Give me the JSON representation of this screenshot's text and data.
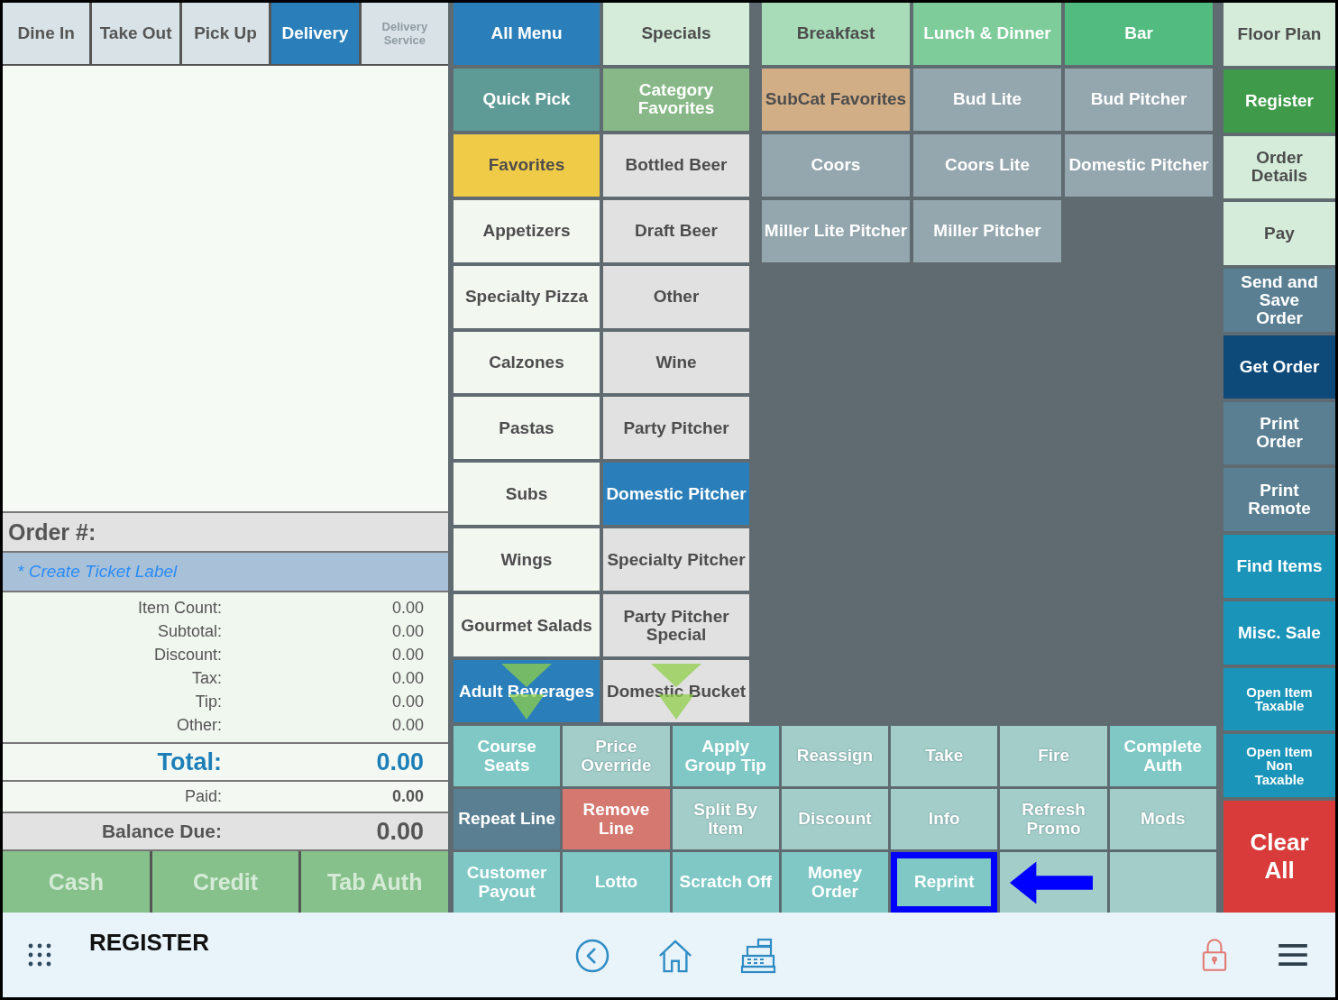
{
  "order_tabs": [
    {
      "label": "Dine In",
      "selected": false,
      "disabled": false
    },
    {
      "label": "Take Out",
      "selected": false,
      "disabled": false
    },
    {
      "label": "Pick Up",
      "selected": false,
      "disabled": false
    },
    {
      "label": "Delivery",
      "selected": true,
      "disabled": false
    },
    {
      "label": "Delivery Service",
      "selected": false,
      "disabled": true
    }
  ],
  "order": {
    "number_label": "Order #:",
    "ticket_label": "* Create Ticket Label",
    "summary": [
      {
        "label": "Item Count:",
        "value": "0.00"
      },
      {
        "label": "Subtotal:",
        "value": "0.00"
      },
      {
        "label": "Discount:",
        "value": "0.00"
      },
      {
        "label": "Tax:",
        "value": "0.00"
      },
      {
        "label": "Tip:",
        "value": "0.00"
      },
      {
        "label": "Other:",
        "value": "0.00"
      }
    ],
    "total": {
      "label": "Total:",
      "value": "0.00"
    },
    "paid": {
      "label": "Paid:",
      "value": "0.00"
    },
    "balance": {
      "label": "Balance Due:",
      "value": "0.00"
    }
  },
  "payment_buttons": [
    {
      "label": "Cash",
      "disabled": true
    },
    {
      "label": "Credit",
      "disabled": true
    },
    {
      "label": "Tab Auth",
      "disabled": true
    }
  ],
  "categories": {
    "more_below": true,
    "items": [
      {
        "label": "All Menu",
        "color": "#2a7fba"
      },
      {
        "label": "Quick Pick",
        "color": "#5f9b96"
      },
      {
        "label": "Favorites",
        "color": "#f0cb48"
      },
      {
        "label": "Appetizers",
        "color": "#f2f7f0"
      },
      {
        "label": "Specialty Pizza",
        "color": "#f2f7f0"
      },
      {
        "label": "Calzones",
        "color": "#f2f7f0"
      },
      {
        "label": "Pastas",
        "color": "#f2f7f0"
      },
      {
        "label": "Subs",
        "color": "#f2f7f0"
      },
      {
        "label": "Wings",
        "color": "#f2f7f0"
      },
      {
        "label": "Gourmet Salads",
        "color": "#f2f7f0"
      },
      {
        "label": "Adult Beverages",
        "color": "#2a7fba"
      }
    ]
  },
  "subcategories": {
    "more_below": true,
    "items": [
      {
        "label": "Specials",
        "color": "#d4ecd9"
      },
      {
        "label": "Category Favorites",
        "color": "#88b887"
      },
      {
        "label": "Bottled Beer",
        "color": "#e1e1e1"
      },
      {
        "label": "Draft Beer",
        "color": "#e1e1e1"
      },
      {
        "label": "Other",
        "color": "#e1e1e1"
      },
      {
        "label": "Wine",
        "color": "#e1e1e1"
      },
      {
        "label": "Party Pitcher",
        "color": "#e1e1e1"
      },
      {
        "label": "Domestic Pitcher",
        "color": "#2a7fba"
      },
      {
        "label": "Specialty Pitcher",
        "color": "#e1e1e1"
      },
      {
        "label": "Party Pitcher Special",
        "color": "#e1e1e1"
      },
      {
        "label": "Domestic Bucket",
        "color": "#e1e1e1"
      }
    ]
  },
  "menu_items": [
    {
      "label": "Breakfast",
      "color": "#a8dcb8"
    },
    {
      "label": "Lunch & Dinner",
      "color": "#7dcc9a"
    },
    {
      "label": "Bar",
      "color": "#52bb80"
    },
    {
      "label": "SubCat Favorites",
      "color": "#d2ae86"
    },
    {
      "label": "Bud Lite",
      "color": "#94a6ae"
    },
    {
      "label": "Bud Pitcher",
      "color": "#94a6ae"
    },
    {
      "label": "Coors",
      "color": "#94a6ae"
    },
    {
      "label": "Coors Lite",
      "color": "#94a6ae"
    },
    {
      "label": "Domestic Pitcher",
      "color": "#94a6ae"
    },
    {
      "label": "Miller Lite Pitcher",
      "color": "#94a6ae"
    },
    {
      "label": "Miller Pitcher",
      "color": "#94a6ae"
    }
  ],
  "actions": [
    {
      "label": "Course Seats",
      "color": "#7fc8c5",
      "disabled": false,
      "highlighted": false
    },
    {
      "label": "Price Override",
      "color": "#a2cdc9",
      "disabled": true,
      "highlighted": false
    },
    {
      "label": "Apply Group Tip",
      "color": "#7fc8c5",
      "disabled": false,
      "highlighted": false
    },
    {
      "label": "Reassign",
      "color": "#a2cdc9",
      "disabled": true,
      "highlighted": false
    },
    {
      "label": "Take",
      "color": "#a2cdc9",
      "disabled": true,
      "highlighted": false
    },
    {
      "label": "Fire",
      "color": "#a2cdc9",
      "disabled": true,
      "highlighted": false
    },
    {
      "label": "Complete Auth",
      "color": "#7fc8c5",
      "disabled": false,
      "highlighted": false
    },
    {
      "label": "Repeat Line",
      "color": "#5a7f92",
      "disabled": false,
      "highlighted": false
    },
    {
      "label": "Remove Line",
      "color": "#d57870",
      "disabled": false,
      "highlighted": false
    },
    {
      "label": "Split By Item",
      "color": "#a2cdc9",
      "disabled": true,
      "highlighted": false
    },
    {
      "label": "Discount",
      "color": "#a2cdc9",
      "disabled": true,
      "highlighted": false
    },
    {
      "label": "Info",
      "color": "#a2cdc9",
      "disabled": true,
      "highlighted": false
    },
    {
      "label": "Refresh Promo",
      "color": "#a2cdc9",
      "disabled": true,
      "highlighted": false
    },
    {
      "label": "Mods",
      "color": "#a2cdc9",
      "disabled": true,
      "highlighted": false
    },
    {
      "label": "Customer Payout",
      "color": "#7fc8c5",
      "disabled": false,
      "highlighted": false
    },
    {
      "label": "Lotto",
      "color": "#7fc8c5",
      "disabled": false,
      "highlighted": false
    },
    {
      "label": "Scratch Off",
      "color": "#7fc8c5",
      "disabled": false,
      "highlighted": false
    },
    {
      "label": "Money Order",
      "color": "#7fc8c5",
      "disabled": false,
      "highlighted": false
    },
    {
      "label": "Reprint",
      "color": "#7fc8c5",
      "disabled": false,
      "highlighted": true
    },
    {
      "color": "#a2cdc9",
      "highlighted": false
    },
    {
      "color": "#a2cdc9",
      "highlighted": false
    }
  ],
  "side_buttons": [
    {
      "label": "Floor Plan",
      "color": "#d4ecd9",
      "kind": "normal"
    },
    {
      "label": "Register",
      "color": "#3f9a4a",
      "kind": "normal"
    },
    {
      "label": "Order Details",
      "color": "#d4ecd9",
      "kind": "normal"
    },
    {
      "label": "Pay",
      "color": "#d4ecd9",
      "kind": "normal"
    },
    {
      "label": "Send and Save Order",
      "color": "#5a7f92",
      "kind": "normal"
    },
    {
      "label": "Get Order",
      "color": "#0d4a7a",
      "kind": "normal"
    },
    {
      "label": "Print Order",
      "color": "#5a7f92",
      "kind": "normal"
    },
    {
      "label": "Print Remote",
      "color": "#5a7f92",
      "kind": "normal"
    },
    {
      "label": "Find Items",
      "color": "#1a94b8",
      "kind": "normal"
    },
    {
      "label": "Misc. Sale",
      "color": "#1a94b8",
      "kind": "normal"
    },
    {
      "label": "Open Item Taxable",
      "color": "#1a94b8",
      "kind": "small"
    },
    {
      "label": "Open Item Non Taxable",
      "color": "#1a94b8",
      "kind": "small"
    },
    {
      "label": "Clear All",
      "color": "#d93a3a",
      "kind": "large"
    }
  ],
  "bottom_bar": {
    "title": "REGISTER"
  }
}
